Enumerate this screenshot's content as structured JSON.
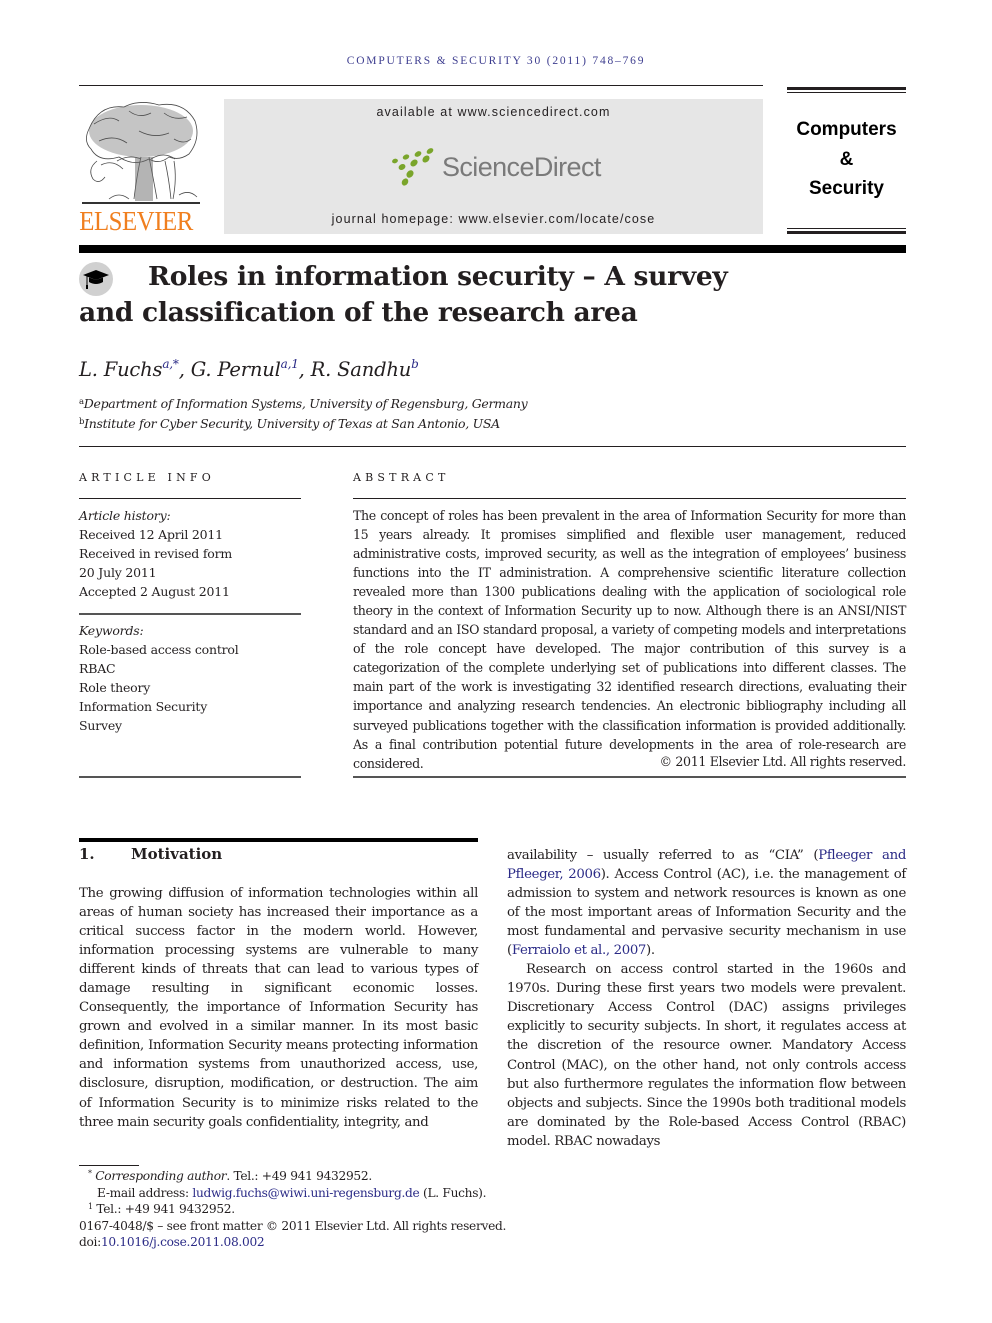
{
  "running_head": "COMPUTERS & SECURITY 30 (2011) 748–769",
  "masthead": {
    "publisher_logo_text": "ELSEVIER",
    "available_at": "available at www.sciencedirect.com",
    "platform_logo_text": "ScienceDirect",
    "journal_homepage": "journal homepage: www.elsevier.com/locate/cose",
    "journal_name_lines": [
      "Computers",
      "&",
      "Security"
    ],
    "colors": {
      "elsevier_orange": "#f07f1f",
      "sciencedirect_green": "#7aa52b",
      "link_blue": "#2a2a86"
    }
  },
  "article": {
    "title": "Roles in information security – A survey and classification of the research area",
    "title_icon": "graduation-cap-icon",
    "authors": [
      {
        "name": "L. Fuchs",
        "marks": "a,*"
      },
      {
        "name": "G. Pernul",
        "marks": "a,1"
      },
      {
        "name": "R. Sandhu",
        "marks": "b"
      }
    ],
    "affiliations": [
      {
        "mark": "a",
        "text": "Department of Information Systems, University of Regensburg, Germany"
      },
      {
        "mark": "b",
        "text": "Institute for Cyber Security, University of Texas at San Antonio, USA"
      }
    ]
  },
  "article_info": {
    "heading": "ARTICLE INFO",
    "history_label": "Article history:",
    "history": [
      "Received 12 April 2011",
      "Received in revised form",
      "20 July 2011",
      "Accepted 2 August 2011"
    ],
    "keywords_label": "Keywords:",
    "keywords": [
      "Role-based access control",
      "RBAC",
      "Role theory",
      "Information Security",
      "Survey"
    ]
  },
  "abstract": {
    "heading": "ABSTRACT",
    "text": "The concept of roles has been prevalent in the area of Information Security for more than 15 years already. It promises simplified and flexible user management, reduced administrative costs, improved security, as well as the integration of employees’ business functions into the IT administration. A comprehensive scientific literature collection revealed more than 1300 publications dealing with the application of sociological role theory in the context of Information Security up to now. Although there is an ANSI/NIST standard and an ISO standard proposal, a variety of competing models and interpretations of the role concept have developed. The major contribution of this survey is a categorization of the complete underlying set of publications into different classes. The main part of the work is investigating 32 identified research directions, evaluating their importance and analyzing research tendencies. An electronic bibliography including all surveyed publications together with the classification information is provided additionally. As a final contribution potential future developments in the area of role-research are considered.",
    "copyright": "© 2011 Elsevier Ltd. All rights reserved."
  },
  "section1": {
    "number": "1.",
    "heading": "Motivation",
    "left_paragraph": "The growing diffusion of information technologies within all areas of human society has increased their importance as a critical success factor in the modern world. However, information processing systems are vulnerable to many different kinds of threats that can lead to various types of damage resulting in significant economic losses. Consequently, the importance of Information Security has grown and evolved in a similar manner. In its most basic definition, Information Security means protecting information and information systems from unauthorized access, use, disclosure, disruption, modification, or destruction. The aim of Information Security is to minimize risks related to the three main security goals confidentiality, integrity, and",
    "right_p1_a": "availability – usually referred to as “CIA” (",
    "right_p1_cite1": "Pfleeger and Pfleeger, 2006",
    "right_p1_b": "). Access Control (AC), i.e. the management of admission to system and network resources is known as one of the most important areas of Information Security and the most fundamental and pervasive security mechanism in use (",
    "right_p1_cite2": "Ferraiolo et al., 2007",
    "right_p1_c": ").",
    "right_p2": "Research on access control started in the 1960s and 1970s. During these first years two models were prevalent. Discretionary Access Control (DAC) assigns privileges explicitly to security subjects. In short, it regulates access at the discretion of the resource owner. Mandatory Access Control (MAC), on the other hand, not only controls access but also furthermore regulates the information flow between objects and subjects. Since the 1990s both traditional models are dominated by the Role-based Access Control (RBAC) model. RBAC nowadays"
  },
  "footnotes": {
    "corr_mark": "*",
    "corr_label": "Corresponding author",
    "corr_tel": ". Tel.: +49 941 9432952.",
    "email_label": "E-mail address: ",
    "email": "ludwig.fuchs@wiwi.uni-regensburg.de",
    "email_owner": " (L. Fuchs).",
    "fn1_mark": "1",
    "fn1_text": " Tel.: +49 941 9432952.",
    "front_matter": "0167-4048/$ – see front matter © 2011 Elsevier Ltd. All rights reserved.",
    "doi_label": "doi:",
    "doi": "10.1016/j.cose.2011.08.002"
  }
}
